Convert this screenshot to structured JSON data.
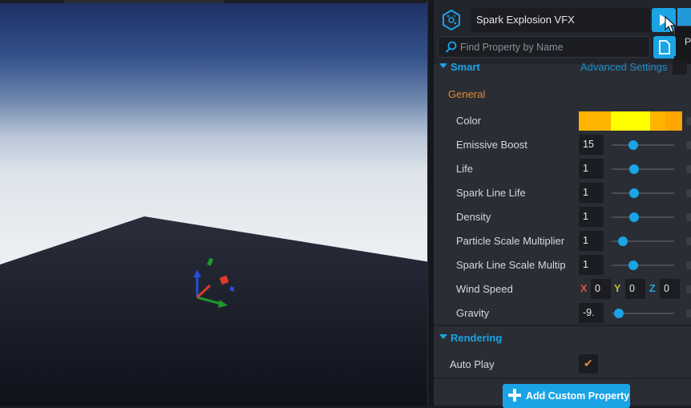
{
  "panel": {
    "title": "Spark Explosion VFX",
    "tooltip_text": "P",
    "search_placeholder": "Find Property by Name",
    "sections": {
      "smart": "Smart",
      "advanced_settings": "Advanced Settings",
      "general": "General",
      "rendering": "Rendering"
    },
    "properties": {
      "color": {
        "label": "Color",
        "swatches": [
          "#ffb400",
          "#ffff00",
          "#ffb400",
          "#ffa500"
        ]
      },
      "emissive_boost": {
        "label": "Emissive Boost",
        "value": "15",
        "slider": 0.35
      },
      "life": {
        "label": "Life",
        "value": "1",
        "slider": 0.36
      },
      "spark_line_life": {
        "label": "Spark Line Life",
        "value": "1",
        "slider": 0.36
      },
      "density": {
        "label": "Density",
        "value": "1",
        "slider": 0.36
      },
      "particle_scale": {
        "label": "Particle Scale Multiplier",
        "value": "1",
        "slider": 0.18
      },
      "spark_line_scale": {
        "label": "Spark Line Scale Multip",
        "value": "1",
        "slider": 0.34
      },
      "wind_speed": {
        "label": "Wind Speed",
        "x_label": "X",
        "x": "0",
        "y_label": "Y",
        "y": "0",
        "z_label": "Z",
        "z": "0"
      },
      "gravity": {
        "label": "Gravity",
        "value": "-9.",
        "slider": 0.12
      }
    },
    "auto_play": {
      "label": "Auto Play",
      "checked_glyph": "✔"
    },
    "add_button": "Add Custom Property"
  },
  "colors": {
    "accent": "#1aa4e6",
    "orange": "#e08a34",
    "axis_x": "#e0553a",
    "axis_y": "#c7c23a",
    "axis_z": "#2fa3e0"
  },
  "icons": [
    "vfx-logo-icon",
    "play-icon",
    "cursor-icon",
    "search-icon",
    "document-icon",
    "triangle-down-icon",
    "checkmark-icon",
    "plus-icon",
    "transform-gizmo-icon"
  ]
}
